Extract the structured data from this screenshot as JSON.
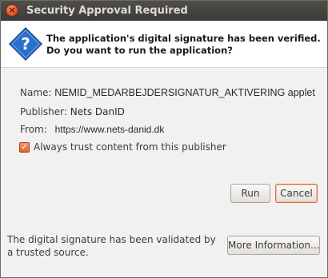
{
  "window": {
    "title": "Security Approval Required"
  },
  "header": {
    "message": "The application's digital signature has been verified. Do you want to run the application?",
    "icon": "question-icon"
  },
  "details": {
    "name_label": "Name:",
    "name_value": "NEMID_MEDARBEJDERSIGNATUR_AKTIVERING applet",
    "publisher_label": "Publisher:",
    "publisher_value": "Nets DanID",
    "from_label": "From:",
    "from_value": "https://www.nets-danid.dk"
  },
  "trust": {
    "checkbox_label": "Always trust content from this publisher",
    "checked": true
  },
  "buttons": {
    "run": "Run",
    "cancel": "Cancel",
    "more_info": "More Information..."
  },
  "footer": {
    "status": "The digital signature has been validated by a trusted source."
  },
  "colors": {
    "accent": "#e4541f",
    "titlebar": "#3c3b37",
    "header_bg": "#ffffff",
    "icon_blue": "#2a6fc9"
  }
}
